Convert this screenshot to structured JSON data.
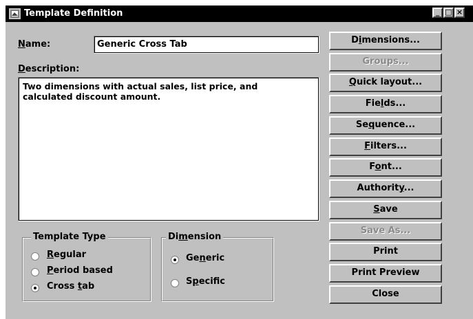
{
  "window": {
    "title": "Template Definition"
  },
  "form": {
    "name_label": "Name:",
    "name_value": "Generic Cross Tab",
    "description_label": "Description:",
    "description_line1": "Two dimensions with actual sales, list price, and",
    "description_line2": "calculated discount amount."
  },
  "buttons": {
    "dimensions": "Dimensions...",
    "groups": "Groups...",
    "quick_layout": "Quick layout...",
    "fields": "Fields...",
    "sequence": "Sequence...",
    "filters": "Filters...",
    "font": "Font...",
    "authority": "Authority...",
    "save": "Save",
    "save_as": "Save As...",
    "print": "Print",
    "print_preview": "Print Preview",
    "close": "Close"
  },
  "template_type": {
    "legend": "Template Type",
    "regular": "Regular",
    "period_based": "Period based",
    "cross_tab": "Cross tab",
    "selected": "Cross tab"
  },
  "dimension": {
    "legend": "Dimension",
    "generic": "Generic",
    "specific": "Specific",
    "selected": "Generic"
  }
}
